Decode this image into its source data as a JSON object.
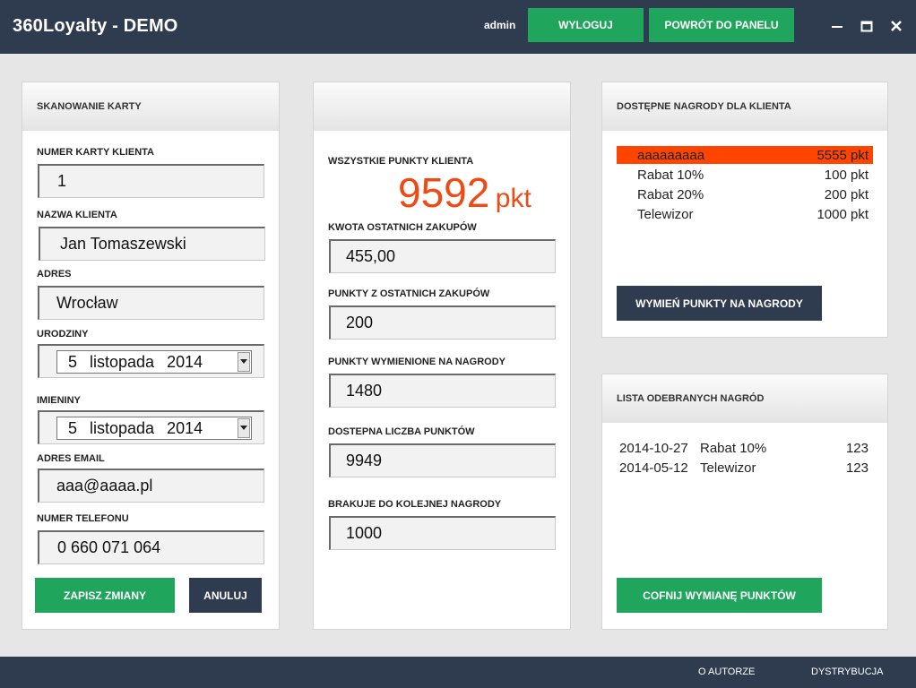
{
  "app": {
    "title": "360Loyalty - DEMO"
  },
  "header": {
    "user": "admin",
    "logout_label": "WYLOGUJ",
    "back_label": "POWRÓT DO PANELU",
    "minimize_glyph": "–",
    "maximize_glyph": "▣",
    "close_glyph": "✕"
  },
  "scan_panel": {
    "title": "SKANOWANIE KARTY",
    "card_number_label": "NUMER KARTY KLIENTA",
    "card_number": "1",
    "client_name_label": "NAZWA KLIENTA",
    "client_name": "Jan Tomaszewski",
    "address_label": "ADRES",
    "address": "Wrocław",
    "birthday_label": "URODZINY",
    "birthday": {
      "day": "5",
      "month": "listopada",
      "year": "2014"
    },
    "nameday_label": "IMIENINY",
    "nameday": {
      "day": "5",
      "month": "listopada",
      "year": "2014"
    },
    "email_label": "ADRES EMAIL",
    "email": "aaa@aaaa.pl",
    "phone_label": "NUMER TELEFONU",
    "phone": "0 660 071 064",
    "save_label": "ZAPISZ ZMIANY",
    "cancel_label": "ANULUJ"
  },
  "points_panel": {
    "title": "",
    "total_label": "WSZYSTKIE PUNKTY KLIENTA",
    "total_value": "9592",
    "total_unit": "pkt",
    "last_purchase_label": "KWOTA OSTATNICH ZAKUPÓW",
    "last_purchase": "455,00",
    "points_last_label": "PUNKTY Z OSTATNICH ZAKUPÓW",
    "points_last": "200",
    "points_exchanged_label": "PUNKTY WYMIENIONE NA NAGRODY",
    "points_exchanged": "1480",
    "available_label": "DOSTEPNA LICZBA PUNKTÓW",
    "available": "9949",
    "missing_label": "BRAKUJE DO KOLEJNEJ NAGRODY",
    "missing": "1000"
  },
  "rewards_panel": {
    "title": "DOSTĘPNE NAGRODY DLA KLIENTA",
    "items": [
      {
        "name": "aaaaaaaaa",
        "points": "5555 pkt",
        "selected": true
      },
      {
        "name": "Rabat 10%",
        "points": "100 pkt",
        "selected": false
      },
      {
        "name": "Rabat 20%",
        "points": "200 pkt",
        "selected": false
      },
      {
        "name": "Telewizor",
        "points": "1000 pkt",
        "selected": false
      }
    ],
    "exchange_label": "WYMIEŃ PUNKTY NA NAGRODY"
  },
  "received_panel": {
    "title": "LISTA ODEBRANYCH NAGRÓD",
    "items": [
      {
        "date": "2014-10-27",
        "name": "Rabat 10%",
        "value": "123"
      },
      {
        "date": "2014-05-12",
        "name": "Telewizor",
        "value": "123"
      }
    ],
    "undo_label": "COFNIJ WYMIANĘ PUNKTÓW"
  },
  "footer": {
    "about_label": "O AUTORZE",
    "distribution_label": "DYSTRYBUCJA"
  },
  "colors": {
    "header_bg": "#2f3b4e",
    "accent_green": "#20a65c",
    "points_orange": "#f04a14",
    "selection": "#ff4500"
  }
}
